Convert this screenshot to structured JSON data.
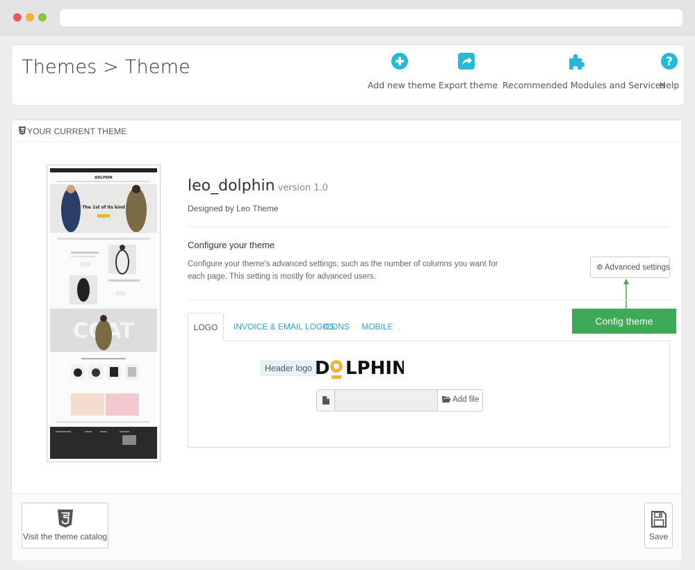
{
  "page": {
    "title": "Themes > Theme"
  },
  "toolbar": {
    "add_new_theme": "Add new theme",
    "export_theme": "Export theme",
    "recommended": "Recommended Modules and Services",
    "help": "Help"
  },
  "panel": {
    "heading": "YOUR CURRENT THEME",
    "theme_name": "leo_dolphin",
    "version": "version 1.0",
    "designed_by": "Designed by Leo Theme",
    "configure_title": "Configure your theme",
    "configure_desc": "Configure your theme's advanced settings, such as the number of columns you want for each page. This setting is mostly for advanced users.",
    "advanced_settings": "Advanced settings",
    "callout": "Config theme"
  },
  "tabs": [
    {
      "label": "LOGO",
      "active": true
    },
    {
      "label": "INVOICE & EMAIL LOGOS",
      "active": false
    },
    {
      "label": "ICONS",
      "active": false
    },
    {
      "label": "MOBILE",
      "active": false
    }
  ],
  "logo_tab": {
    "header_logo_label": "Header logo",
    "logo_text": "DOLPHIN",
    "add_file": "Add file",
    "file_value": ""
  },
  "thumbnail": {
    "hero_text": "The 1st of its kind",
    "section_text": "COAT"
  },
  "footer": {
    "catalog_button": "Visit the theme catalog",
    "save_button": "Save"
  },
  "colors": {
    "accent_blue": "#25b9d7",
    "callout_green": "#3eaa55",
    "tab_link": "#2aa3d8"
  },
  "icons": {
    "add": "plus-circle-icon",
    "export": "share-icon",
    "modules": "puzzle-icon",
    "help": "question-circle-icon",
    "html5": "html5-icon",
    "file": "file-icon",
    "folder": "folder-open-icon",
    "gear": "gear-icon",
    "save": "floppy-disk-icon"
  }
}
